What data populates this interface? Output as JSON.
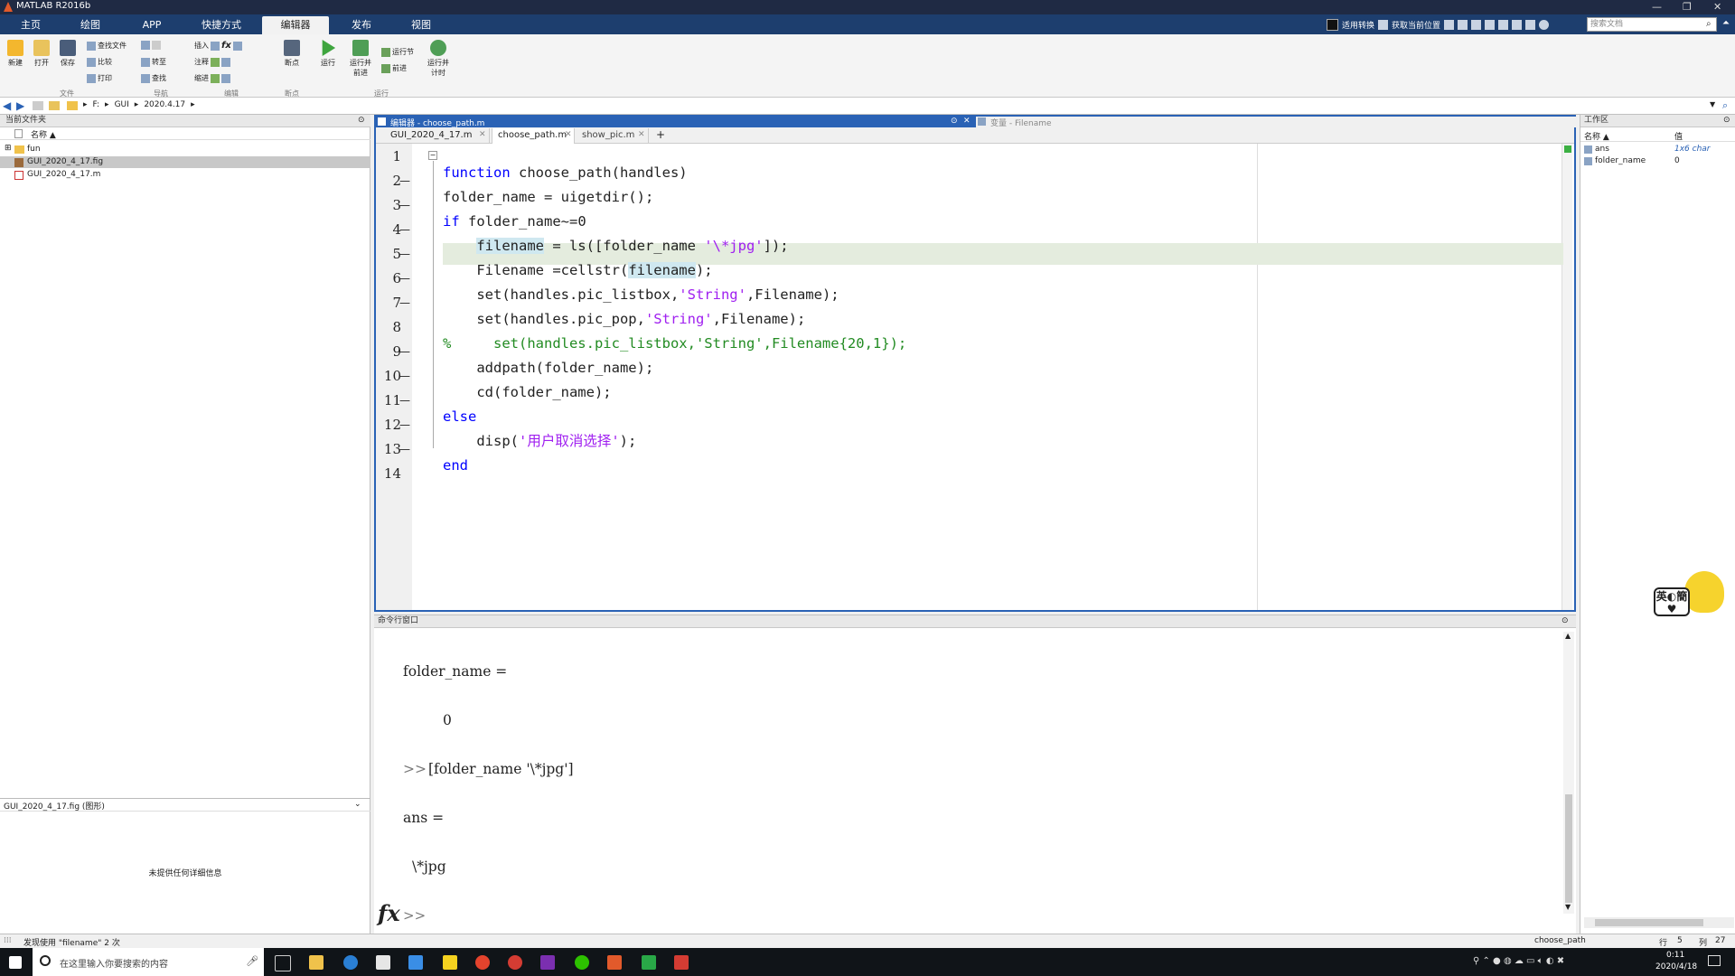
{
  "window": {
    "title": "MATLAB R2016b",
    "controls": [
      "—",
      "❐",
      "✕"
    ]
  },
  "ribbon_tabs": [
    "主页",
    "绘图",
    "APP",
    "快捷方式",
    "编辑器",
    "发布",
    "视图"
  ],
  "active_tab": "编辑器",
  "quick_access": {
    "item1": "适用转换",
    "item2": "获取当前位置"
  },
  "search_docs_placeholder": "搜索文档",
  "ribbon": {
    "file": {
      "new": "新建",
      "open": "打开",
      "save": "保存",
      "find_files": "查找文件",
      "compare": "比较",
      "print": "打印",
      "group": "文件"
    },
    "navigate": {
      "goto": "转至",
      "find": "查找",
      "group": "导航"
    },
    "edit": {
      "insert": "插入",
      "comment": "注释",
      "indent": "缩进",
      "fx": "fx",
      "group": "编辑"
    },
    "breakpoints": {
      "label": "断点",
      "group": "断点"
    },
    "run": {
      "run": "运行",
      "run_advance": "运行并前进",
      "run_section": "运行节",
      "advance": "前进",
      "run_time": "运行并计时",
      "group": "运行"
    }
  },
  "address": {
    "path": [
      "F:",
      "GUI",
      "2020.4.17"
    ]
  },
  "current_folder": {
    "title": "当前文件夹",
    "column_name": "名称 ▲",
    "items": [
      "fun",
      "GUI_2020_4_17.fig",
      "GUI_2020_4_17.m"
    ],
    "details_select": "GUI_2020_4_17.fig  (图形)",
    "details_text": "未提供任何详细信息"
  },
  "editor": {
    "title": "编辑器 - choose_path.m",
    "variables_title": "变量 - Filename",
    "tabs": [
      "GUI_2020_4_17.m",
      "choose_path.m",
      "show_pic.m"
    ],
    "active_tab": "choose_path.m",
    "add_tab": "+",
    "line_numbers": [
      "1",
      "2",
      "3",
      "4",
      "5",
      "6",
      "7",
      "8",
      "9",
      "10",
      "11",
      "12",
      "13",
      "14"
    ]
  },
  "command_window": {
    "title": "命令行窗口",
    "lines": [
      "folder_name =",
      "0",
      ">> ",
      "[folder_name '\\*jpg']",
      "ans =",
      "\\*jpg"
    ],
    "prompt": ">>",
    "fx": "fx"
  },
  "workspace": {
    "title": "工作区",
    "col_name": "名称 ▲",
    "col_value": "值",
    "vars": [
      {
        "name": "ans",
        "value": "1x6 char"
      },
      {
        "name": "folder_name",
        "value": "0"
      }
    ]
  },
  "status": {
    "message": "发现使用 \"filename\" 2 次",
    "function": "choose_path",
    "row_label": "行",
    "row": "5",
    "col_label": "列",
    "col": "27"
  },
  "taskbar": {
    "search_placeholder": "在这里输入你要搜索的内容",
    "time": "0:11",
    "date": "2020/4/18"
  },
  "mascot_text": "英◐簡♥"
}
